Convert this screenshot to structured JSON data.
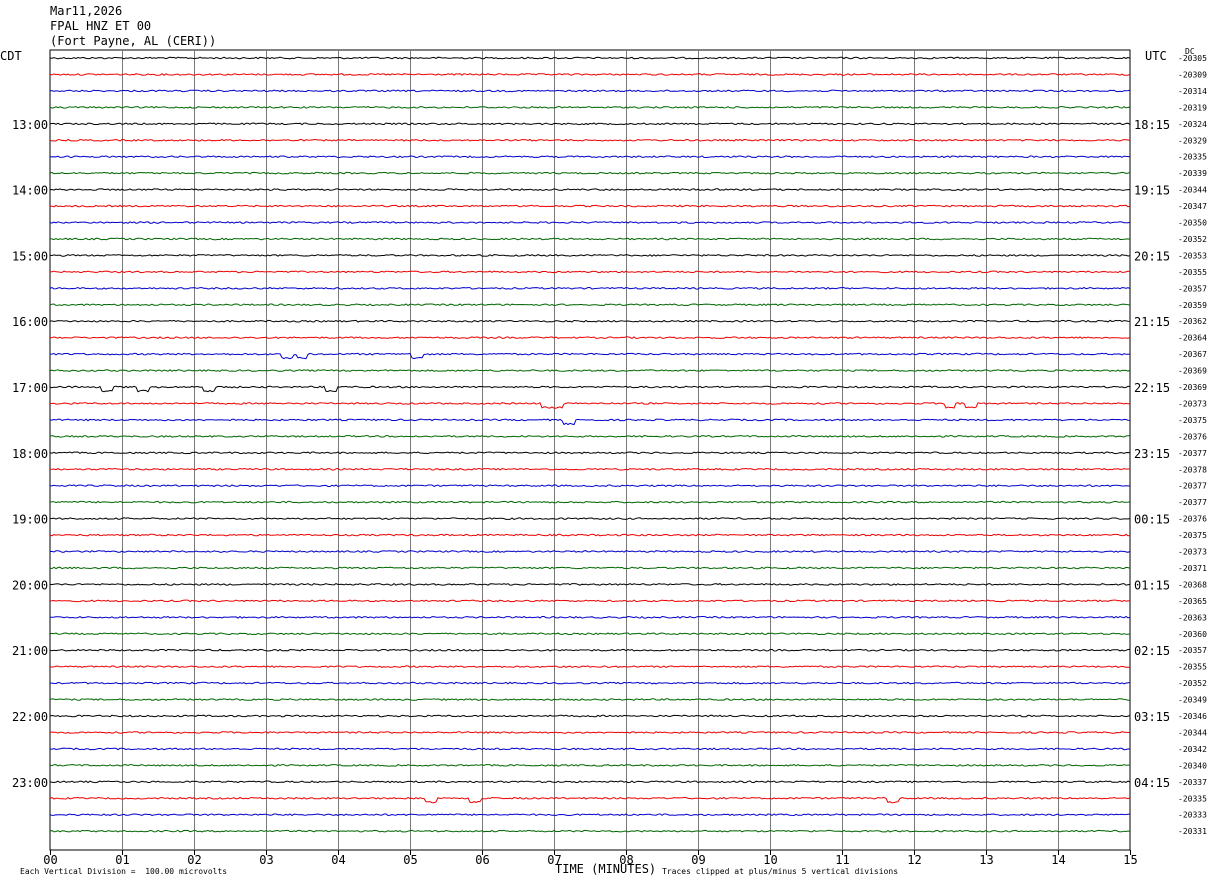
{
  "header": {
    "date": "Mar11,2026",
    "station": "FPAL HNZ ET 00",
    "location": "(Fort Payne, AL (CERI))"
  },
  "left_label": "CDT",
  "right_label": "UTC",
  "dc_label": "DC",
  "footer": {
    "xlabel": "TIME (MINUTES)",
    "scale_note": "Each Vertical Division =  100.00 microvolts",
    "clip_note": "Traces clipped at plus/minus 5 vertical divisions"
  },
  "chart_data": {
    "type": "line",
    "title": "FPAL HNZ ET 00",
    "xlabel": "TIME (MINUTES)",
    "xlim": [
      0,
      15
    ],
    "x_ticks": [
      "00",
      "01",
      "02",
      "03",
      "04",
      "05",
      "06",
      "07",
      "08",
      "09",
      "10",
      "11",
      "12",
      "13",
      "14",
      "15"
    ],
    "trace_colors": [
      "#000000",
      "#ee0000",
      "#0000cc",
      "#006600"
    ],
    "rows_per_hour": 4,
    "left_time_labels": [
      "13:00",
      "14:00",
      "15:00",
      "16:00",
      "17:00",
      "18:00",
      "19:00",
      "20:00",
      "21:00",
      "22:00",
      "23:00"
    ],
    "right_time_labels": [
      "18:15",
      "19:15",
      "20:15",
      "21:15",
      "22:15",
      "23:15",
      "00:15",
      "01:15",
      "02:15",
      "03:15",
      "04:15"
    ],
    "dc_offsets": [
      "-20305",
      "-20309",
      "-20314",
      "-20319",
      "-20324",
      "-20329",
      "-20335",
      "-20339",
      "-20344",
      "-20347",
      "-20350",
      "-20352",
      "-20353",
      "-20355",
      "-20357",
      "-20359",
      "-20362",
      "-20364",
      "-20367",
      "-20369",
      "-20369",
      "-20373",
      "-20375",
      "-20376",
      "-20377",
      "-20378",
      "-20377",
      "-20377",
      "-20376",
      "-20375",
      "-20373",
      "-20371",
      "-20368",
      "-20365",
      "-20363",
      "-20360",
      "-20357",
      "-20355",
      "-20352",
      "-20349",
      "-20346",
      "-20344",
      "-20342",
      "-20340",
      "-20337",
      "-20335",
      "-20333",
      "-20331"
    ],
    "events": [
      {
        "row": 18,
        "minutes": [
          3.3,
          3.5,
          5.1
        ]
      },
      {
        "row": 20,
        "minutes": [
          0.8,
          1.3,
          2.2,
          3.9
        ]
      },
      {
        "row": 21,
        "minutes": [
          6.9,
          7.05,
          12.5,
          12.8
        ]
      },
      {
        "row": 22,
        "minutes": [
          7.2
        ]
      },
      {
        "row": 45,
        "minutes": [
          5.3,
          5.9,
          11.7
        ]
      }
    ]
  }
}
